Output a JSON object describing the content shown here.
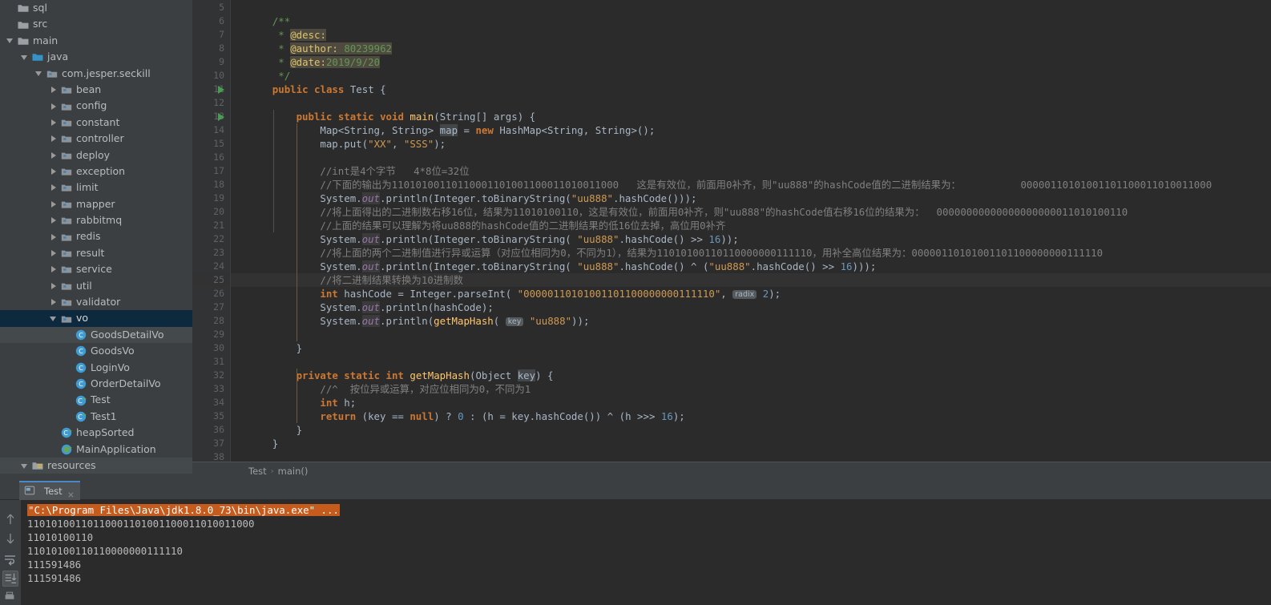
{
  "sidebar": {
    "name": "project-tree",
    "items": [
      {
        "label": "sql",
        "indent": 0,
        "arrow": "none",
        "icon": "folder-icon",
        "state": "normal"
      },
      {
        "label": "src",
        "indent": 0,
        "arrow": "none",
        "icon": "folder-icon",
        "state": "normal"
      },
      {
        "label": "main",
        "indent": 0,
        "arrow": "down",
        "icon": "folder-module-icon",
        "state": "normal"
      },
      {
        "label": "java",
        "indent": 1,
        "arrow": "down",
        "icon": "folder-source-icon",
        "state": "normal"
      },
      {
        "label": "com.jesper.seckill",
        "indent": 2,
        "arrow": "down",
        "icon": "package-icon",
        "state": "normal"
      },
      {
        "label": "bean",
        "indent": 3,
        "arrow": "right",
        "icon": "package-icon",
        "state": "normal"
      },
      {
        "label": "config",
        "indent": 3,
        "arrow": "right",
        "icon": "package-icon",
        "state": "normal"
      },
      {
        "label": "constant",
        "indent": 3,
        "arrow": "right",
        "icon": "package-icon",
        "state": "normal"
      },
      {
        "label": "controller",
        "indent": 3,
        "arrow": "right",
        "icon": "package-icon",
        "state": "normal"
      },
      {
        "label": "deploy",
        "indent": 3,
        "arrow": "right",
        "icon": "package-icon",
        "state": "normal"
      },
      {
        "label": "exception",
        "indent": 3,
        "arrow": "right",
        "icon": "package-icon",
        "state": "normal"
      },
      {
        "label": "limit",
        "indent": 3,
        "arrow": "right",
        "icon": "package-icon",
        "state": "normal"
      },
      {
        "label": "mapper",
        "indent": 3,
        "arrow": "right",
        "icon": "package-icon",
        "state": "normal"
      },
      {
        "label": "rabbitmq",
        "indent": 3,
        "arrow": "right",
        "icon": "package-icon",
        "state": "normal"
      },
      {
        "label": "redis",
        "indent": 3,
        "arrow": "right",
        "icon": "package-icon",
        "state": "normal"
      },
      {
        "label": "result",
        "indent": 3,
        "arrow": "right",
        "icon": "package-icon",
        "state": "normal"
      },
      {
        "label": "service",
        "indent": 3,
        "arrow": "right",
        "icon": "package-icon",
        "state": "normal"
      },
      {
        "label": "util",
        "indent": 3,
        "arrow": "right",
        "icon": "package-icon",
        "state": "normal"
      },
      {
        "label": "validator",
        "indent": 3,
        "arrow": "right",
        "icon": "package-icon",
        "state": "normal"
      },
      {
        "label": "vo",
        "indent": 3,
        "arrow": "down",
        "icon": "package-icon",
        "state": "selected"
      },
      {
        "label": "GoodsDetailVo",
        "indent": 4,
        "arrow": "none",
        "icon": "class-icon",
        "state": "hover"
      },
      {
        "label": "GoodsVo",
        "indent": 4,
        "arrow": "none",
        "icon": "class-icon",
        "state": "normal"
      },
      {
        "label": "LoginVo",
        "indent": 4,
        "arrow": "none",
        "icon": "class-icon",
        "state": "normal"
      },
      {
        "label": "OrderDetailVo",
        "indent": 4,
        "arrow": "none",
        "icon": "class-icon",
        "state": "normal"
      },
      {
        "label": "Test",
        "indent": 4,
        "arrow": "none",
        "icon": "class-runnable-icon",
        "state": "normal"
      },
      {
        "label": "Test1",
        "indent": 4,
        "arrow": "none",
        "icon": "class-runnable-icon",
        "state": "normal"
      },
      {
        "label": "heapSorted",
        "indent": 3,
        "arrow": "none",
        "icon": "class-runnable-icon",
        "state": "normal"
      },
      {
        "label": "MainApplication",
        "indent": 3,
        "arrow": "none",
        "icon": "class-spring-icon",
        "state": "normal"
      },
      {
        "label": "resources",
        "indent": 1,
        "arrow": "down",
        "icon": "folder-resources-icon",
        "state": "hover"
      }
    ]
  },
  "editor": {
    "name": "code-editor",
    "file": "Test.java",
    "first_line_number": 5,
    "last_line_number": 38,
    "current_line": 25,
    "run_gutter_lines": [
      11,
      13
    ],
    "lines": [
      {
        "n": 5,
        "text": ""
      },
      {
        "n": 6,
        "text": "    /**"
      },
      {
        "n": 7,
        "text": "     * @desc:"
      },
      {
        "n": 8,
        "text": "     * @author: 80239962"
      },
      {
        "n": 9,
        "text": "     * @date:2019/9/20"
      },
      {
        "n": 10,
        "text": "     */"
      },
      {
        "n": 11,
        "text": "    public class Test {"
      },
      {
        "n": 12,
        "text": ""
      },
      {
        "n": 13,
        "text": "        public static void main(String[] args) {"
      },
      {
        "n": 14,
        "text": "            Map<String, String> map = new HashMap<String, String>();"
      },
      {
        "n": 15,
        "text": "            map.put(\"XX\", \"SSS\");"
      },
      {
        "n": 16,
        "text": ""
      },
      {
        "n": 17,
        "text": "            //int是4个字节   4*8位=32位"
      },
      {
        "n": 18,
        "text": "            //下面的输出为11010100110110001101001100011010011000   这是有效位，前面用0补齐，则\"uu888\"的hashCode值的二进制结果为：          00000110101001101100011010011000"
      },
      {
        "n": 19,
        "text": "            System.out.println(Integer.toBinaryString(\"uu888\".hashCode()));"
      },
      {
        "n": 20,
        "text": "            //将上面得出的二进制数右移16位，结果为11010100110，这是有效位，前面用0补齐，则\"uu888\"的hashCode值右移16位的结果为：  00000000000000000000011010100110"
      },
      {
        "n": 21,
        "text": "            //上面的结果可以理解为将uu888的hashCode值的二进制结果的低16位去掉，高位用0补齐"
      },
      {
        "n": 22,
        "text": "            System.out.println(Integer.toBinaryString( \"uu888\".hashCode() >> 16));"
      },
      {
        "n": 23,
        "text": "            //将上面的两个二进制值进行异或运算（对应位相同为0，不同为1），结果为11010100110110000000111110，用补全高位结果为：00000110101001101100000000111110"
      },
      {
        "n": 24,
        "text": "            System.out.println(Integer.toBinaryString( \"uu888\".hashCode() ^ (\"uu888\".hashCode() >> 16)));"
      },
      {
        "n": 25,
        "text": "            //将二进制结果转换为10进制数"
      },
      {
        "n": 26,
        "text": "            int hashCode = Integer.parseInt( \"00000110101001101100000000111110\", radix 2);"
      },
      {
        "n": 27,
        "text": "            System.out.println(hashCode);"
      },
      {
        "n": 28,
        "text": "            System.out.println(getMapHash( key \"uu888\"));"
      },
      {
        "n": 29,
        "text": ""
      },
      {
        "n": 30,
        "text": "        }"
      },
      {
        "n": 31,
        "text": ""
      },
      {
        "n": 32,
        "text": "        private static int getMapHash(Object key) {"
      },
      {
        "n": 33,
        "text": "            //^  按位异或运算，对应位相同为0，不同为1"
      },
      {
        "n": 34,
        "text": "            int h;"
      },
      {
        "n": 35,
        "text": "            return (key == null) ? 0 : (h = key.hashCode()) ^ (h >>> 16);"
      },
      {
        "n": 36,
        "text": "        }"
      },
      {
        "n": 37,
        "text": "    }"
      },
      {
        "n": 38,
        "text": ""
      }
    ],
    "inlay_hints": {
      "radix": "radix",
      "key": "key"
    }
  },
  "breadcrumb": {
    "name": "editor-breadcrumb",
    "items": [
      "Test",
      "main()"
    ],
    "separator": "›"
  },
  "run_panel": {
    "name": "run-tool-window",
    "tab_label": "Test",
    "toolbar": [
      {
        "name": "up-arrow-icon",
        "title": "Up the Stack Trace"
      },
      {
        "name": "down-arrow-icon",
        "title": "Down the Stack Trace"
      },
      {
        "name": "soft-wrap-icon",
        "title": "Soft-Wrap"
      },
      {
        "name": "scroll-to-end-icon",
        "title": "Scroll to End"
      },
      {
        "name": "print-icon",
        "title": "Print"
      }
    ],
    "console": {
      "name": "console-output",
      "command_line": "\"C:\\Program Files\\Java\\jdk1.8.0_73\\bin\\java.exe\" ...",
      "lines": [
        "11010100110110001101001100011010011000",
        "11010100110",
        "11010100110110000000111110",
        "111591486",
        "111591486"
      ]
    }
  },
  "colors": {
    "editor_bg": "#2b2b2b",
    "panel_bg": "#3c3f41",
    "gutter_bg": "#313335",
    "selection_blue": "#0d293e",
    "tab_accent": "#4a88c7",
    "keyword_orange": "#cc7832",
    "string_orange": "#d09a53",
    "comment_gray": "#808080",
    "number_blue": "#6897bb",
    "field_purple": "#9876aa",
    "method_yellow": "#ffc66d",
    "javadoc_green": "#629755",
    "run_green": "#499c54",
    "cmd_highlight": "#c55b1c"
  }
}
